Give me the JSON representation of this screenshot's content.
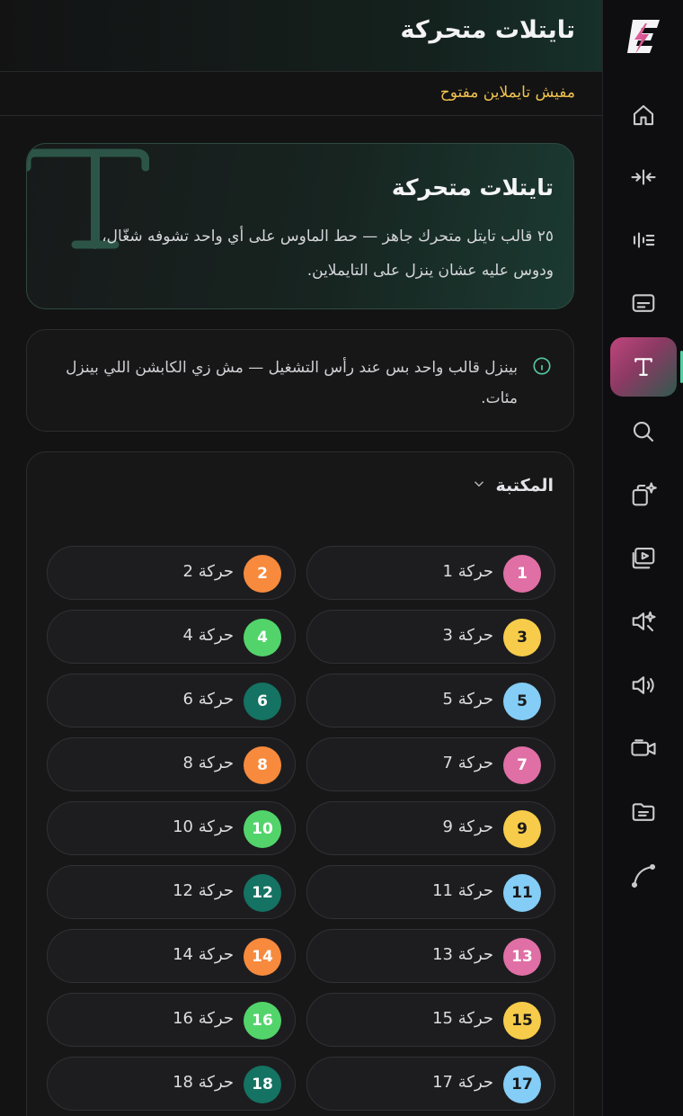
{
  "header": {
    "title": "تايتلات متحركة"
  },
  "timeline": {
    "status": "مفيش تايملاين مفتوح"
  },
  "hero": {
    "title": "تايتلات متحركة",
    "description": "٢٥ قالب تايتل متحرك جاهز — حط الماوس على أي واحد تشوفه شغّال، ودوس عليه عشان ينزل على التايملاين."
  },
  "info": {
    "text": "بينزل قالب واحد بس عند رأس التشغيل — مش زي الكابشن اللي بينزل مئات."
  },
  "library": {
    "title": "المكتبة",
    "items": [
      {
        "label": "حركة 1",
        "num": "1",
        "color": "#e06fa5",
        "text_color": "#ffffff"
      },
      {
        "label": "حركة 2",
        "num": "2",
        "color": "#f78a3d",
        "text_color": "#ffffff"
      },
      {
        "label": "حركة 3",
        "num": "3",
        "color": "#f7cc4a",
        "text_color": "#1a1a1a"
      },
      {
        "label": "حركة 4",
        "num": "4",
        "color": "#52d46b",
        "text_color": "#ffffff"
      },
      {
        "label": "حركة 5",
        "num": "5",
        "color": "#84cdf6",
        "text_color": "#1a1a1a"
      },
      {
        "label": "حركة 6",
        "num": "6",
        "color": "#147362",
        "text_color": "#ffffff"
      },
      {
        "label": "حركة 7",
        "num": "7",
        "color": "#e06fa5",
        "text_color": "#ffffff"
      },
      {
        "label": "حركة 8",
        "num": "8",
        "color": "#f78a3d",
        "text_color": "#ffffff"
      },
      {
        "label": "حركة 9",
        "num": "9",
        "color": "#f7cc4a",
        "text_color": "#1a1a1a"
      },
      {
        "label": "حركة 10",
        "num": "10",
        "color": "#52d46b",
        "text_color": "#ffffff"
      },
      {
        "label": "حركة 11",
        "num": "11",
        "color": "#84cdf6",
        "text_color": "#1a1a1a"
      },
      {
        "label": "حركة 12",
        "num": "12",
        "color": "#147362",
        "text_color": "#ffffff"
      },
      {
        "label": "حركة 13",
        "num": "13",
        "color": "#e06fa5",
        "text_color": "#ffffff"
      },
      {
        "label": "حركة 14",
        "num": "14",
        "color": "#f78a3d",
        "text_color": "#ffffff"
      },
      {
        "label": "حركة 15",
        "num": "15",
        "color": "#f7cc4a",
        "text_color": "#1a1a1a"
      },
      {
        "label": "حركة 16",
        "num": "16",
        "color": "#52d46b",
        "text_color": "#ffffff"
      },
      {
        "label": "حركة 17",
        "num": "17",
        "color": "#84cdf6",
        "text_color": "#1a1a1a"
      },
      {
        "label": "حركة 18",
        "num": "18",
        "color": "#147362",
        "text_color": "#ffffff"
      }
    ]
  },
  "sidebar": {
    "items": [
      {
        "icon": "home-icon"
      },
      {
        "icon": "split-icon"
      },
      {
        "icon": "waveform-icon"
      },
      {
        "icon": "captions-icon"
      },
      {
        "icon": "text-icon",
        "active": true
      },
      {
        "icon": "search-icon"
      },
      {
        "icon": "sparkle-layers-icon"
      },
      {
        "icon": "media-library-icon"
      },
      {
        "icon": "ai-voice-icon"
      },
      {
        "icon": "volume-icon"
      },
      {
        "icon": "camera-icon"
      },
      {
        "icon": "folder-icon"
      },
      {
        "icon": "bezier-curve-icon"
      }
    ]
  },
  "colors": {
    "accent": "#4fd3a4",
    "status": "#f0c24e",
    "brand_pink": "#e06fa5"
  }
}
